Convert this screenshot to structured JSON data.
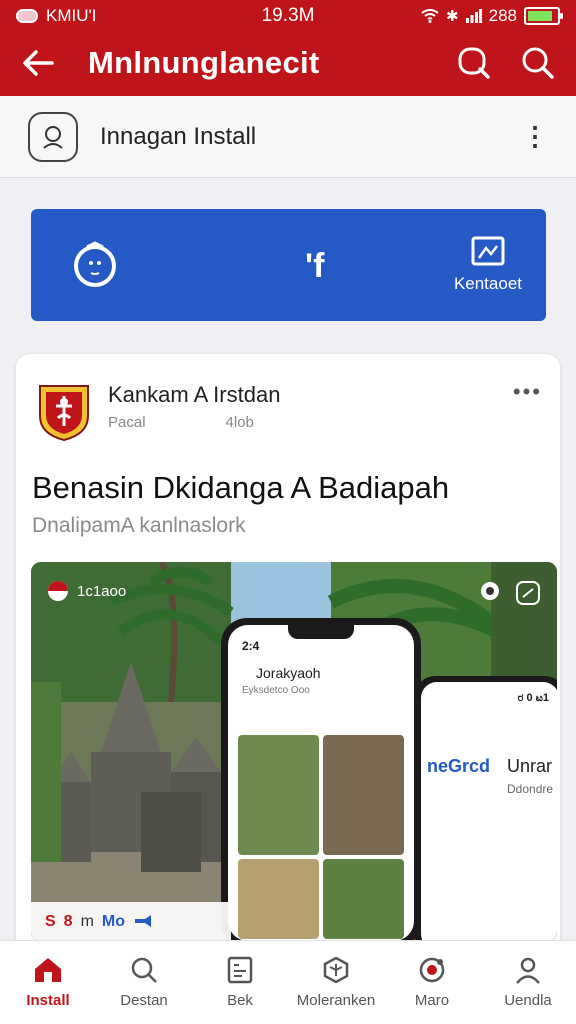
{
  "status": {
    "carrier": "KMIU'I",
    "time": "19.3M",
    "battery_text": "288",
    "battery_level": 0.85,
    "battery_color": "#7ee35a"
  },
  "appbar": {
    "title": "Mnlnunglanecit",
    "back_icon": "arrow-left-icon",
    "action_icons": [
      "search-icon",
      "search-icon"
    ],
    "bg_color": "#c0141b"
  },
  "install_row": {
    "icon": "lens-icon",
    "label": "Innagan Install",
    "more": "⋮"
  },
  "banner": {
    "bg_color": "#2559c6",
    "left_icon": "face-icon",
    "fb_text": "'f",
    "right_icon": "image-icon",
    "right_label": "Kentaoet"
  },
  "post": {
    "author": "Kankam A Irstdan",
    "meta_left": "Pacal",
    "meta_right": "4lob",
    "dots": "•••",
    "headline": "Benasin Dkidanga A Badiapah",
    "subhead": "DnalipamA kanlnaslork",
    "photo": {
      "flag_label": "1c1aoo",
      "bottom_s": "S",
      "bottom_8": "8",
      "bottom_m": "m",
      "bottom_mo": "Mo",
      "phone": {
        "time": "2:4",
        "title": "Jorakyaoh",
        "subtitle": "Eyksdetco Ooo"
      },
      "phone2": {
        "page": "ರ 0 ಟ1",
        "label_left": "neGrcd",
        "label_right": "Unrar",
        "label_sub": "Ddondre"
      }
    }
  },
  "bottom_nav": [
    {
      "label": "Install",
      "icon": "home-icon",
      "active": true
    },
    {
      "label": "Destan",
      "icon": "search-icon",
      "active": false
    },
    {
      "label": "Bek",
      "icon": "document-icon",
      "active": false
    },
    {
      "label": "Moleranken",
      "icon": "cube-icon",
      "active": false
    },
    {
      "label": "Marо",
      "icon": "camera-icon",
      "active": false
    },
    {
      "label": "Uendla",
      "icon": "person-icon",
      "active": false
    }
  ],
  "accent_color": "#c0141b"
}
